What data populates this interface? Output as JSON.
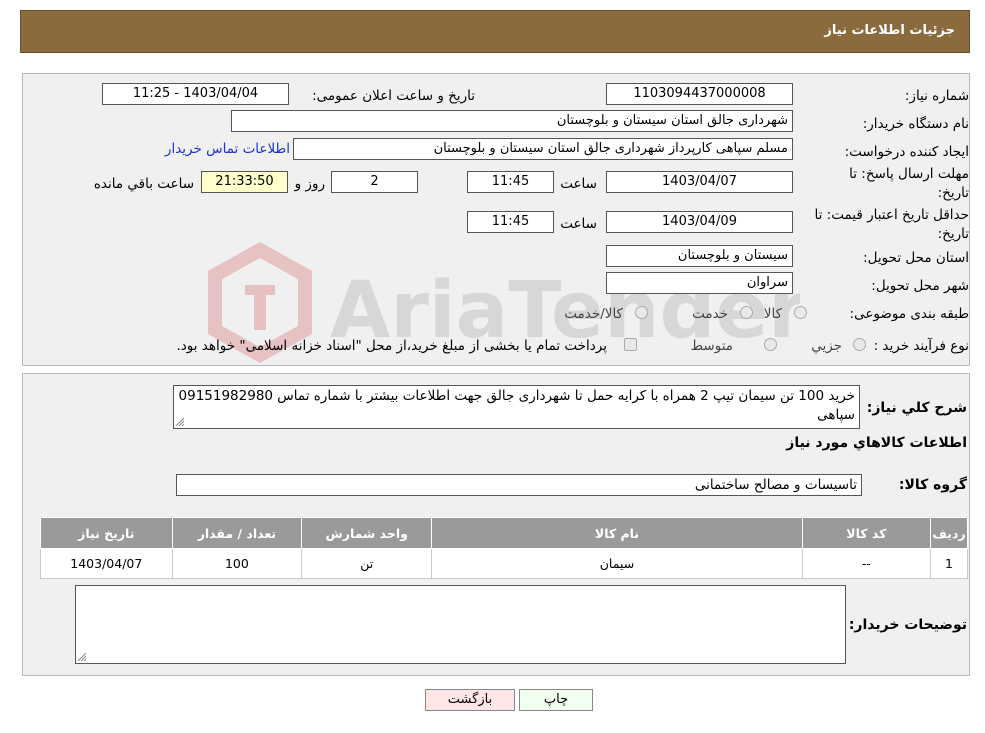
{
  "header": {
    "title": "جزئیات اطلاعات نیاز"
  },
  "form": {
    "need_number_label": "شماره نیاز:",
    "need_number": "1103094437000008",
    "announce_label": "تاریخ و ساعت اعلان عمومی:",
    "announce_value": "1403/04/04 - 11:25",
    "buyer_org_label": "نام دستگاه خریدار:",
    "buyer_org": "شهرداری جالق استان سیستان و بلوچستان",
    "creator_label": "ایجاد کننده درخواست:",
    "creator": "مسلم سپاهی کارپرداز شهرداری جالق استان سیستان و بلوچستان",
    "contact_link": "اطلاعات تماس خریدار",
    "deadline_label": "مهلت ارسال پاسخ: تا تاریخ:",
    "deadline_date": "1403/04/07",
    "time_label": "ساعت",
    "deadline_time": "11:45",
    "days_value": "2",
    "days_label": "روز و",
    "remaining_value": "21:33:50",
    "remaining_label": "ساعت باقي مانده",
    "price_validity_label": "حداقل تاریخ اعتبار قیمت: تا تاریخ:",
    "price_validity_date": "1403/04/09",
    "price_validity_time": "11:45",
    "province_label": "استان محل تحویل:",
    "province": "سیستان و بلوچستان",
    "city_label": "شهر محل تحویل:",
    "city": "سراوان",
    "category_label": "طبقه بندی موضوعی:",
    "category_options": [
      "کالا",
      "خدمت",
      "کالا/خدمت"
    ],
    "process_label": "نوع فرآیند خرید :",
    "process_options": [
      "جزيي",
      "متوسط"
    ],
    "process_note": "پرداخت تمام یا بخشی از مبلغ خرید،از محل \"اسناد خزانه اسلامی\" خواهد بود."
  },
  "details": {
    "description_label": "شرح کلي نياز:",
    "description": "خرید 100 تن سیمان تیپ 2 همراه با کرایه حمل تا شهرداری جالق جهت اطلاعات بیشتر با شماره تماس 09151982980 سپاهی",
    "goods_info_title": "اطلاعات کالاهاي مورد نياز",
    "goods_group_label": "گروه کالا:",
    "goods_group": "تاسیسات و مصالح ساختمانی",
    "table": {
      "headers": [
        "رديف",
        "کد کالا",
        "نام کالا",
        "واحد شمارش",
        "تعداد / مقدار",
        "تاريخ نياز"
      ],
      "rows": [
        [
          "1",
          "--",
          "سیمان",
          "تن",
          "100",
          "1403/04/07"
        ]
      ]
    },
    "buyer_notes_label": "توضيحات خريدار:"
  },
  "buttons": {
    "print": "چاپ",
    "back": "بازگشت"
  },
  "watermark": "AriaTender.neT"
}
